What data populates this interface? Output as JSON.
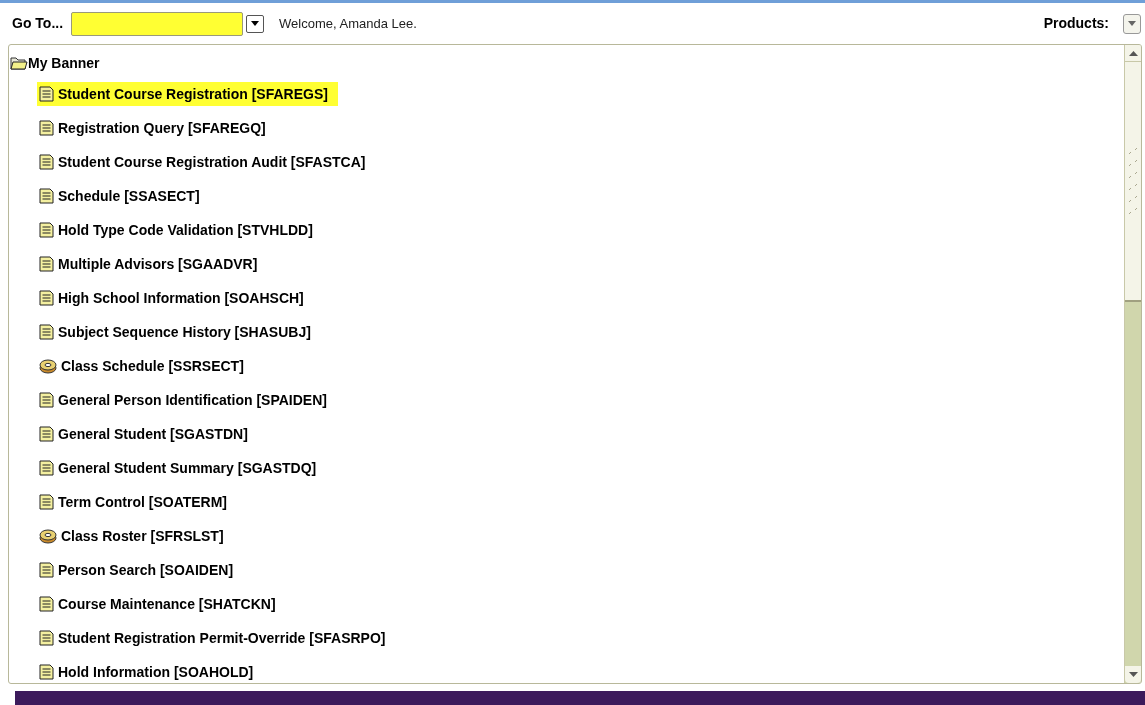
{
  "toolbar": {
    "goto_label": "Go To...",
    "welcome": "Welcome, Amanda Lee.",
    "products_label": "Products:"
  },
  "tree": {
    "label": "My Banner",
    "expanded": true,
    "children": [
      {
        "label": "Student Course Registration [SFAREGS]",
        "kind": "form",
        "selected": true
      },
      {
        "label": "Registration Query [SFAREGQ]",
        "kind": "form",
        "selected": false
      },
      {
        "label": "Student Course Registration Audit [SFASTCA]",
        "kind": "form",
        "selected": false
      },
      {
        "label": "Schedule [SSASECT]",
        "kind": "form",
        "selected": false
      },
      {
        "label": "Hold Type Code Validation [STVHLDD]",
        "kind": "form",
        "selected": false
      },
      {
        "label": "Multiple Advisors [SGAADVR]",
        "kind": "form",
        "selected": false
      },
      {
        "label": "High School Information [SOAHSCH]",
        "kind": "form",
        "selected": false
      },
      {
        "label": "Subject Sequence History [SHASUBJ]",
        "kind": "form",
        "selected": false
      },
      {
        "label": "Class Schedule [SSRSECT]",
        "kind": "job",
        "selected": false
      },
      {
        "label": "General Person Identification [SPAIDEN]",
        "kind": "form",
        "selected": false
      },
      {
        "label": "General Student [SGASTDN]",
        "kind": "form",
        "selected": false
      },
      {
        "label": "General Student Summary [SGASTDQ]",
        "kind": "form",
        "selected": false
      },
      {
        "label": "Term Control [SOATERM]",
        "kind": "form",
        "selected": false
      },
      {
        "label": "Class Roster [SFRSLST]",
        "kind": "job",
        "selected": false
      },
      {
        "label": "Person Search [SOAIDEN]",
        "kind": "form",
        "selected": false
      },
      {
        "label": "Course Maintenance [SHATCKN]",
        "kind": "form",
        "selected": false
      },
      {
        "label": "Student Registration Permit-Override [SFASRPO]",
        "kind": "form",
        "selected": false
      },
      {
        "label": "Hold Information [SOAHOLD]",
        "kind": "form",
        "selected": false
      }
    ]
  }
}
